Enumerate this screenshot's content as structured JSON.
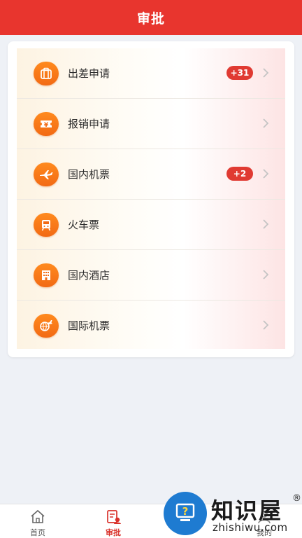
{
  "header": {
    "title": "审批"
  },
  "approval_items": [
    {
      "label": "出差申请",
      "icon": "suitcase-icon",
      "badge": "+31"
    },
    {
      "label": "报销申请",
      "icon": "ticket-yen-icon",
      "badge": ""
    },
    {
      "label": "国内机票",
      "icon": "airplane-icon",
      "badge": "+2"
    },
    {
      "label": "火车票",
      "icon": "train-icon",
      "badge": ""
    },
    {
      "label": "国内酒店",
      "icon": "hotel-icon",
      "badge": ""
    },
    {
      "label": "国际机票",
      "icon": "globe-plane-icon",
      "badge": ""
    }
  ],
  "tabbar": {
    "home": "首页",
    "approval": "审批",
    "mine": "我的"
  },
  "watermark": {
    "name": "知识屋",
    "url": "zhishiwu.com",
    "reg": "®"
  },
  "colors": {
    "brand_red": "#e8352e",
    "icon_orange": "#f47a18",
    "badge_red": "#e03a32"
  }
}
